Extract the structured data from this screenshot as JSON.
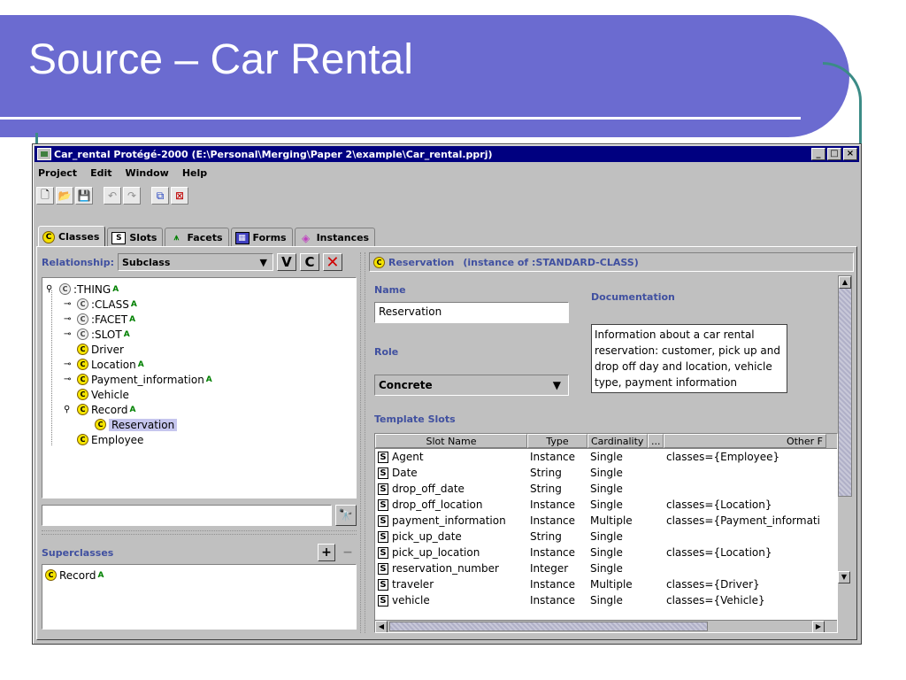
{
  "slide": {
    "title": "Source – Car Rental"
  },
  "window": {
    "title": "Car_rental  Protégé-2000    (E:\\Personal\\Merging\\Paper 2\\example\\Car_rental.pprj)",
    "controls": {
      "minimize": "_",
      "maximize": "□",
      "close": "×"
    }
  },
  "menu": {
    "items": [
      "Project",
      "Edit",
      "Window",
      "Help"
    ]
  },
  "toolbar": {
    "buttons": [
      {
        "name": "new-project-icon",
        "glyph": "🗋"
      },
      {
        "name": "open-project-icon",
        "glyph": "📂"
      },
      {
        "name": "save-project-icon",
        "glyph": "💾"
      },
      {
        "name": "undo-icon",
        "glyph": "↶"
      },
      {
        "name": "redo-icon",
        "glyph": "↷"
      },
      {
        "name": "cascade-windows-icon",
        "glyph": "⧉"
      },
      {
        "name": "close-windows-icon",
        "glyph": "⊠"
      }
    ]
  },
  "tabs": [
    {
      "label": "Classes",
      "icon": "c-icon",
      "glyph": "C"
    },
    {
      "label": "Slots",
      "icon": "s-icon",
      "glyph": "S"
    },
    {
      "label": "Facets",
      "icon": "facets-icon",
      "glyph": "⩚"
    },
    {
      "label": "Forms",
      "icon": "forms-icon",
      "glyph": "▦"
    },
    {
      "label": "Instances",
      "icon": "instances-icon",
      "glyph": "◈"
    }
  ],
  "classes_tab": {
    "relationship_label": "Relationship:",
    "relationship_value": "Subclass",
    "buttons": {
      "v": "V",
      "c": "C",
      "x": "✕"
    },
    "tree": [
      {
        "label": ":THING",
        "depth": 0,
        "toggle": "⚲",
        "system": true,
        "abstract": "A"
      },
      {
        "label": ":CLASS",
        "depth": 1,
        "toggle": "⊸",
        "system": true,
        "abstract": "A"
      },
      {
        "label": ":FACET",
        "depth": 1,
        "toggle": "⊸",
        "system": true,
        "abstract": "A"
      },
      {
        "label": ":SLOT",
        "depth": 1,
        "toggle": "⊸",
        "system": true,
        "abstract": "A"
      },
      {
        "label": "Driver",
        "depth": 1,
        "toggle": "",
        "system": false,
        "abstract": ""
      },
      {
        "label": "Location",
        "depth": 1,
        "toggle": "⊸",
        "system": false,
        "abstract": "A"
      },
      {
        "label": "Payment_information",
        "depth": 1,
        "toggle": "⊸",
        "system": false,
        "abstract": "A"
      },
      {
        "label": "Vehicle",
        "depth": 1,
        "toggle": "",
        "system": false,
        "abstract": ""
      },
      {
        "label": "Record",
        "depth": 1,
        "toggle": "⚲",
        "system": false,
        "abstract": "A"
      },
      {
        "label": "Reservation",
        "depth": 2,
        "toggle": "",
        "system": false,
        "abstract": "",
        "selected": true
      },
      {
        "label": "Employee",
        "depth": 1,
        "toggle": "",
        "system": false,
        "abstract": ""
      }
    ],
    "search_placeholder": "",
    "search_icon": "binoculars-icon",
    "superclasses_label": "Superclasses",
    "superclasses_add": "+",
    "superclasses_remove": "−",
    "superclasses": [
      {
        "label": "Record",
        "abstract": "A"
      }
    ]
  },
  "form": {
    "header_name": "Reservation",
    "header_suffix": "(instance of :STANDARD-CLASS)",
    "name_label": "Name",
    "name_value": "Reservation",
    "role_label": "Role",
    "role_value": "Concrete",
    "documentation_label": "Documentation",
    "documentation_value": "Information about a car rental reservation: customer, pick up and drop off day and location, vehicle type, payment information",
    "template_slots_label": "Template Slots"
  },
  "slot_table": {
    "headers": [
      "Slot Name",
      "Type",
      "Cardinality",
      "...",
      "Other F"
    ],
    "rows": [
      {
        "name": "Agent",
        "type": "Instance",
        "cardinality": "Single",
        "other": "classes={Employee}"
      },
      {
        "name": "Date",
        "type": "String",
        "cardinality": "Single",
        "other": ""
      },
      {
        "name": "drop_off_date",
        "type": "String",
        "cardinality": "Single",
        "other": ""
      },
      {
        "name": "drop_off_location",
        "type": "Instance",
        "cardinality": "Single",
        "other": "classes={Location}"
      },
      {
        "name": "payment_information",
        "type": "Instance",
        "cardinality": "Multiple",
        "other": "classes={Payment_informati"
      },
      {
        "name": "pick_up_date",
        "type": "String",
        "cardinality": "Single",
        "other": ""
      },
      {
        "name": "pick_up_location",
        "type": "Instance",
        "cardinality": "Single",
        "other": "classes={Location}"
      },
      {
        "name": "reservation_number",
        "type": "Integer",
        "cardinality": "Single",
        "other": ""
      },
      {
        "name": "traveler",
        "type": "Instance",
        "cardinality": "Multiple",
        "other": "classes={Driver}"
      },
      {
        "name": "vehicle",
        "type": "Instance",
        "cardinality": "Single",
        "other": "classes={Vehicle}"
      }
    ]
  },
  "colors": {
    "banner": "#6b6bd0",
    "titlebar": "#000080",
    "label_blue": "#4050a0",
    "abstract_green": "#008000",
    "selection": "#c6c6ee"
  }
}
